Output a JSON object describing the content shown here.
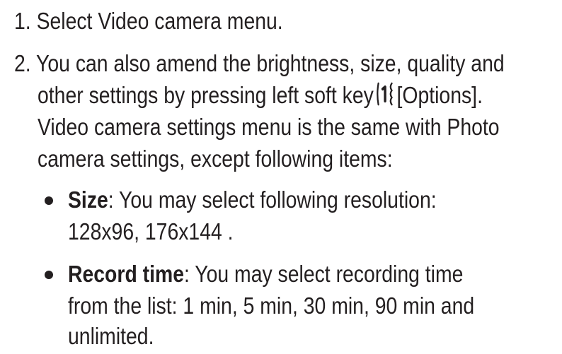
{
  "steps": [
    {
      "number": "1.",
      "text": "Select Video camera menu."
    },
    {
      "number": "2.",
      "line1": "You can also amend the brightness, size, quality and",
      "line2_before": "other settings by pressing left soft key",
      "line2_after": "[Options].",
      "line3": "Video camera settings menu is the same with Photo",
      "line4": "camera settings, except following items:",
      "key_icon": "left-soft-key-icon"
    }
  ],
  "bullets": [
    {
      "term": "Size",
      "line1": ": You may select following resolution:",
      "line2": "128x96, 176x144 ."
    },
    {
      "term": "Record time",
      "line1": ": You may select recording time",
      "line2": "from the list: 1 min, 5 min, 30 min, 90 min and",
      "line3": "unlimited."
    }
  ]
}
